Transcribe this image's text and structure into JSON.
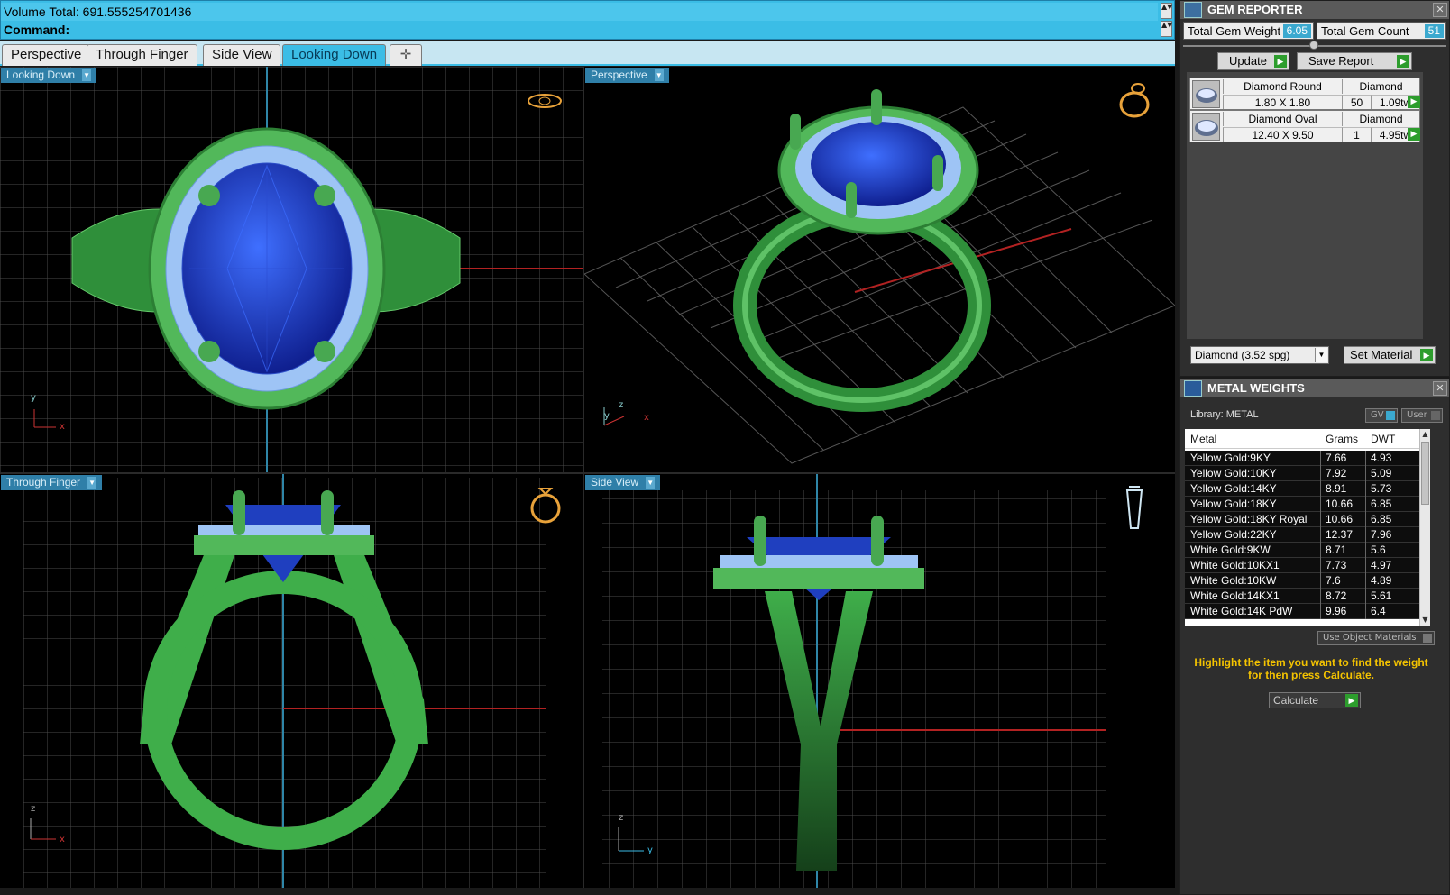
{
  "command": {
    "volume_text": "Volume Total: 691.555254701436",
    "command_label": "Command:"
  },
  "tabs": [
    {
      "label": "Perspective",
      "active": false
    },
    {
      "label": "Through Finger",
      "active": false
    },
    {
      "label": "Side View",
      "active": false
    },
    {
      "label": "Looking Down",
      "active": true
    }
  ],
  "add_tab_icon": "plus-icon",
  "viewports": {
    "looking_down": {
      "label": "Looking Down",
      "axis_a": "y",
      "axis_b": "x"
    },
    "perspective": {
      "label": "Perspective",
      "axis_a": "z",
      "axis_b": "x",
      "axis_c": "y"
    },
    "through_finger": {
      "label": "Through Finger",
      "axis_a": "z",
      "axis_b": "x"
    },
    "side_view": {
      "label": "Side View",
      "axis_a": "z",
      "axis_b": "y"
    }
  },
  "gem_reporter": {
    "title": "GEM REPORTER",
    "total_weight_label": "Total Gem Weight",
    "total_weight": "6.05",
    "total_count_label": "Total Gem Count",
    "total_count": "51",
    "update_label": "Update",
    "save_label": "Save Report",
    "gems": [
      {
        "name": "Diamond Round",
        "size": "1.80 X 1.80",
        "material": "Diamond",
        "count": "50",
        "weight": "1.09tw"
      },
      {
        "name": "Diamond Oval",
        "size": "12.40 X 9.50",
        "material": "Diamond",
        "count": "1",
        "weight": "4.95tw"
      }
    ],
    "material_select": "Diamond    (3.52 spg)",
    "set_material_label": "Set Material"
  },
  "metal_weights": {
    "title": "METAL WEIGHTS",
    "library_label": "Library: METAL",
    "gv_label": "GV",
    "user_label": "User",
    "columns": [
      "Metal",
      "Grams",
      "DWT"
    ],
    "rows": [
      {
        "metal": "Yellow Gold:9KY",
        "grams": "7.66",
        "dwt": "4.93"
      },
      {
        "metal": "Yellow Gold:10KY",
        "grams": "7.92",
        "dwt": "5.09"
      },
      {
        "metal": "Yellow Gold:14KY",
        "grams": "8.91",
        "dwt": "5.73"
      },
      {
        "metal": "Yellow Gold:18KY",
        "grams": "10.66",
        "dwt": "6.85"
      },
      {
        "metal": "Yellow Gold:18KY Royal",
        "grams": "10.66",
        "dwt": "6.85"
      },
      {
        "metal": "Yellow Gold:22KY",
        "grams": "12.37",
        "dwt": "7.96"
      },
      {
        "metal": "White Gold:9KW",
        "grams": "8.71",
        "dwt": "5.6"
      },
      {
        "metal": "White Gold:10KX1",
        "grams": "7.73",
        "dwt": "4.97"
      },
      {
        "metal": "White Gold:10KW",
        "grams": "7.6",
        "dwt": "4.89"
      },
      {
        "metal": "White Gold:14KX1",
        "grams": "8.72",
        "dwt": "5.61"
      },
      {
        "metal": "White Gold:14K PdW",
        "grams": "9.96",
        "dwt": "6.4"
      }
    ],
    "use_object_label": "Use Object Materials",
    "hint": "Highlight the item you want to find the weight for then press Calculate.",
    "calculate_label": "Calculate"
  },
  "colors": {
    "accent": "#3bbde6",
    "metal_green": "#3fae4a",
    "stone_blue": "#1f3fbf",
    "hint_yellow": "#f5c400"
  }
}
